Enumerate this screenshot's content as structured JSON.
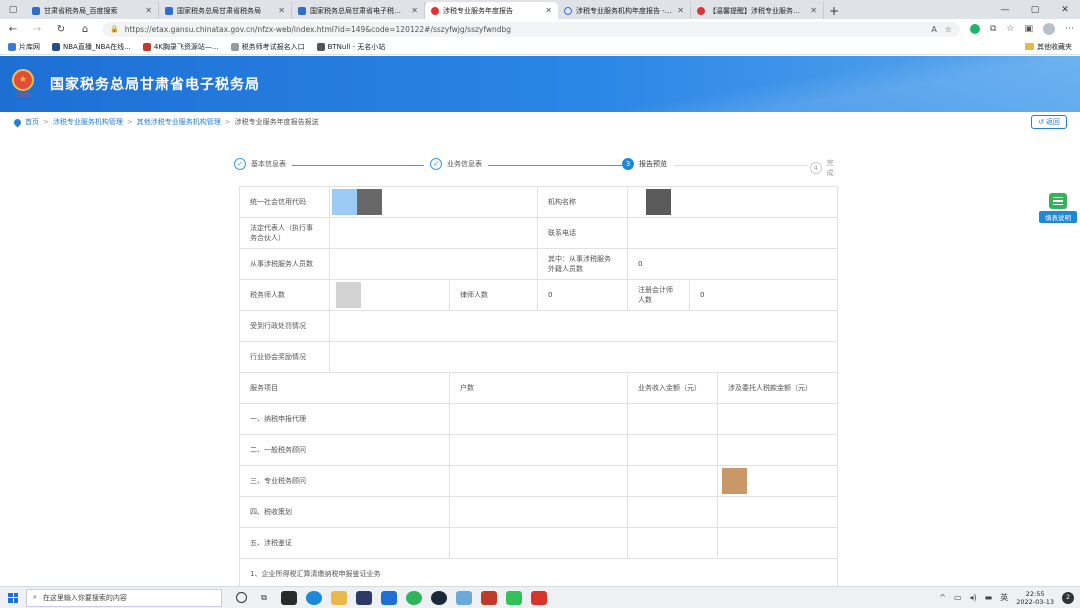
{
  "browser": {
    "tabs": [
      {
        "title": "甘肃省税务局_百度搜索",
        "active": false
      },
      {
        "title": "国家税务总局甘肃省税务局",
        "active": false
      },
      {
        "title": "国家税务总局甘肃省电子税务局",
        "active": false
      },
      {
        "title": "涉税专业服务年度报告",
        "active": true
      },
      {
        "title": "涉税专业服务机构年度报告 - 搜",
        "active": false
      },
      {
        "title": "【温馨提醒】涉税专业服务机构年",
        "active": false
      }
    ],
    "url": "https://etax.gansu.chinatax.gov.cn/nfzx-web/index.html?id=149&code=120122#/sszyfwjg/sszyfwndbg",
    "bookmarks": [
      "片库网",
      "NBA直播_NBA在线...",
      "4K胸录飞资源站—...",
      "税务师考试报名入口",
      "BTNull - 无名小站"
    ],
    "bookmarks_right": "其他收藏夹"
  },
  "header": {
    "emblem_text": "中国税务",
    "title": "国家税务总局甘肃省电子税务局"
  },
  "breadcrumb": {
    "items": [
      "首页",
      "涉税专业服务机构管理",
      "其他涉税专业服务机构管理"
    ],
    "current": "涉税专业服务年度报告报送"
  },
  "back_label": "返回",
  "help_label": "填表说明",
  "steps": [
    {
      "num": "✓",
      "label": "基本信息表",
      "state": "done"
    },
    {
      "num": "✓",
      "label": "业务信息表",
      "state": "done"
    },
    {
      "num": "3",
      "label": "报告预览",
      "state": "current"
    },
    {
      "num": "4",
      "label": "完成",
      "state": "todo"
    }
  ],
  "form": {
    "credit_code_label": "统一社会信用代码",
    "org_name_label": "机构名称",
    "legal_rep_label": "法定代表人（执行事务合伙人）",
    "phone_label": "联系电话",
    "staff_label": "从事涉税服务人员数",
    "foreign_staff_label": "其中：从事涉税服务外籍人员数",
    "foreign_staff_value": "0",
    "tax_agent_label": "税务师人数",
    "lawyer_label": "律师人数",
    "lawyer_value": "0",
    "cpa_label": "注册会计师人数",
    "cpa_value": "0",
    "penalty_label": "受到行政处罚情况",
    "award_label": "行业协会奖励情况",
    "columns": [
      "服务项目",
      "户数",
      "业务收入金额（元）",
      "涉及委托人税款金额（元）"
    ],
    "services": [
      "一、纳税申报代理",
      "二、一般税务顾问",
      "三、专业税务顾问",
      "四、税收策划",
      "五、涉税鉴证",
      "1、企业所得税汇算清缴纳税申报鉴证业务"
    ]
  },
  "taskbar": {
    "search_placeholder": "在这里输入你要搜索的内容",
    "time": "22:55",
    "date": "2022-03-13",
    "notif_count": "2"
  }
}
